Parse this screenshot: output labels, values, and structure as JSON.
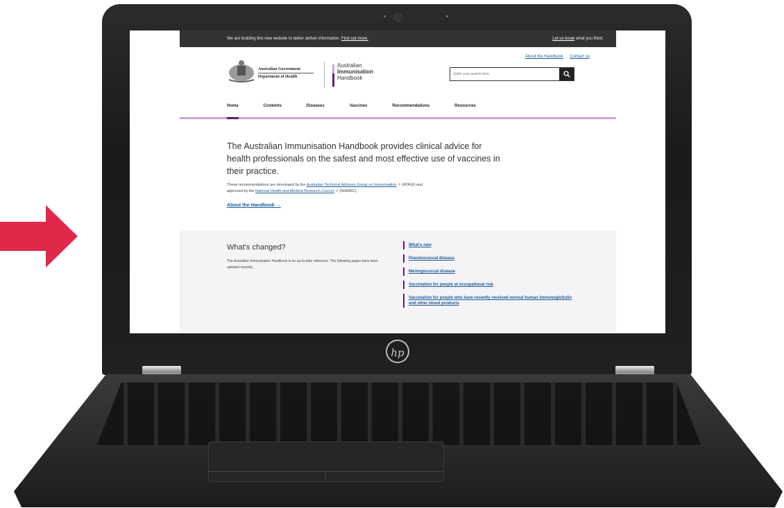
{
  "topbar": {
    "notice_text": "We are building this new website to better deliver information.",
    "notice_link": "Find out more.",
    "feedback_link": "Let us know",
    "feedback_text": "what you think."
  },
  "header": {
    "gov_line1": "Australian Government",
    "gov_line2": "Department of Health",
    "brand_line1": "Australian",
    "brand_line2": "Immunisation",
    "brand_line3": "Handbook",
    "util_about": "About the Handbook",
    "util_contact": "Contact us",
    "search_placeholder": "Enter your search term"
  },
  "nav": {
    "items": [
      "Home",
      "Contents",
      "Diseases",
      "Vaccines",
      "Recommendations",
      "Resources"
    ],
    "active": "Home"
  },
  "hero": {
    "title": "The Australian Immunisation Handbook provides clinical advice for health professionals on the safest and most effective use of vaccines in their practice.",
    "body_start": "These recommendations are developed by the",
    "atagi_link": "Australian Technical Advisory Group on Immunisation",
    "body_mid": "(ATAGI) and approved by the",
    "nhmrc_link": "National Health and Medical Research Council",
    "body_end": "(NHMRC).",
    "about_link": "About the Handbook →"
  },
  "changed": {
    "title": "What's changed?",
    "body": "The Australian Immunisation Handbook is an up-to-date reference. The following pages have been updated recently.",
    "items": [
      "What's new",
      "Pneumococcal disease",
      "Meningococcal disease",
      "Vaccination for people at occupational risk",
      "Vaccination for people who have recently received normal human immunoglobulin and other blood products"
    ]
  },
  "device": {
    "logo": "hp",
    "arrow_color": "#e0294a"
  },
  "colors": {
    "accent_purple": "#5b1f6e",
    "accent_lilac": "#c9a6d3",
    "link_blue": "#1a5c99"
  }
}
